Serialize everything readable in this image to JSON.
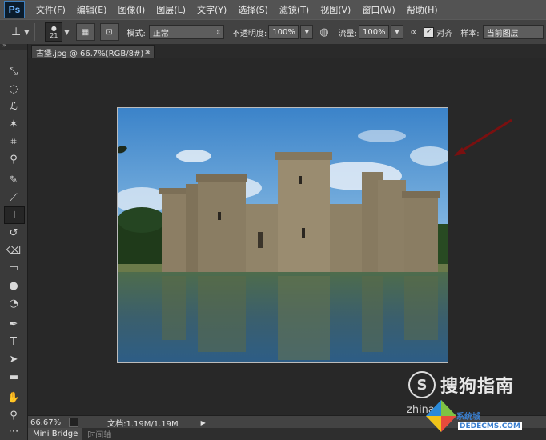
{
  "app": {
    "logo": "Ps"
  },
  "menu": [
    "文件(F)",
    "编辑(E)",
    "图像(I)",
    "图层(L)",
    "文字(Y)",
    "选择(S)",
    "滤镜(T)",
    "视图(V)",
    "窗口(W)",
    "帮助(H)"
  ],
  "options": {
    "brush_size": "21",
    "mode_label": "模式:",
    "mode_value": "正常",
    "opacity_label": "不透明度:",
    "opacity_value": "100%",
    "flow_label": "流量:",
    "flow_value": "100%",
    "align_label": "对齐",
    "align_checked": "✓",
    "sample_label": "样本:",
    "sample_value": "当前图层"
  },
  "document": {
    "tab_title": "古堡.jpg @ 66.7%(RGB/8#) *",
    "close": "×"
  },
  "status": {
    "zoom": "66.67%",
    "doc_info": "文档:1.19M/1.19M"
  },
  "bottom_tabs": [
    "Mini Bridge",
    "时间轴"
  ],
  "watermark": {
    "logo": "S",
    "brand": "搜狗指南",
    "sub": "zhinan",
    "site_cn": "系统城",
    "site_en": "DEDECMS.COM",
    "partial": "系统城"
  },
  "tools": [
    "move-icon",
    "marquee-icon",
    "lasso-icon",
    "magic-wand-icon",
    "crop-icon",
    "eyedropper-icon",
    "healing-brush-icon",
    "brush-icon",
    "clone-stamp-icon",
    "history-brush-icon",
    "eraser-icon",
    "gradient-icon",
    "blur-icon",
    "dodge-icon",
    "pen-icon",
    "type-icon",
    "path-selection-icon",
    "rectangle-icon",
    "hand-icon",
    "zoom-icon"
  ]
}
